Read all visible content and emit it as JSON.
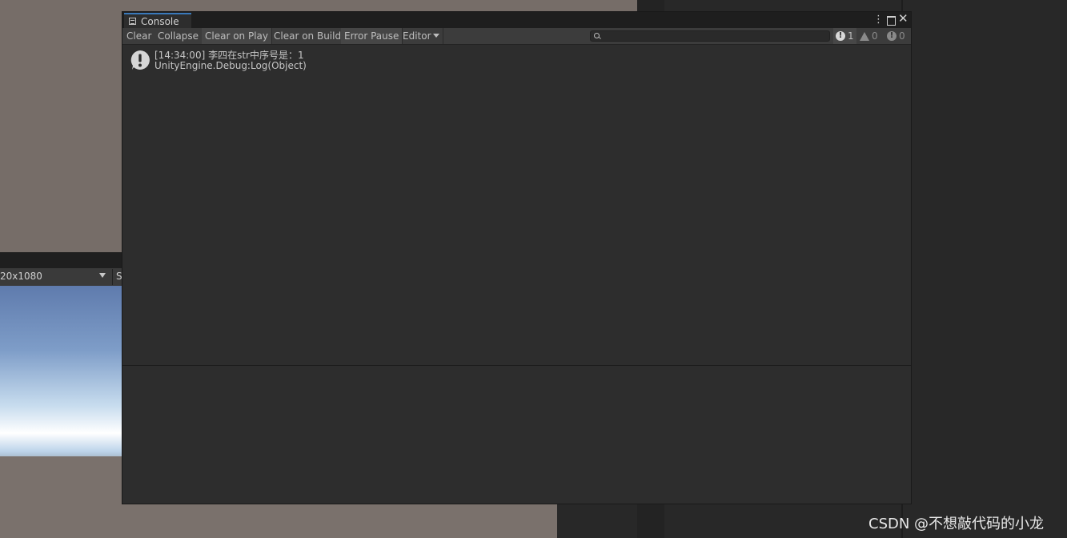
{
  "background": {
    "game_view": {
      "resolution_label": "20x1080",
      "next_label": "S"
    }
  },
  "console": {
    "tab_title": "Console",
    "window_controls": {
      "menu_glyph": "⋮",
      "close_glyph": "✕"
    },
    "toolbar": {
      "clear": "Clear",
      "collapse": "Collapse",
      "clear_on_play": "Clear on Play",
      "clear_on_build": "Clear on Build",
      "error_pause": "Error Pause",
      "editor": "Editor",
      "search_placeholder": ""
    },
    "counters": {
      "info_count": "1",
      "warning_count": "0",
      "error_count": "0",
      "info_glyph": "!",
      "error_glyph": "!"
    },
    "log_entries": [
      {
        "message": "[14:34:00] 李四在str中序号是：1",
        "stack": "UnityEngine.Debug:Log(Object)",
        "icon": "info-icon"
      }
    ]
  },
  "watermark": "CSDN @不想敲代码的小龙",
  "colors": {
    "accent_tab": "#3a79bb",
    "panel_bg": "#2d2d2d",
    "toolbar_bg": "#3c3c3c"
  }
}
